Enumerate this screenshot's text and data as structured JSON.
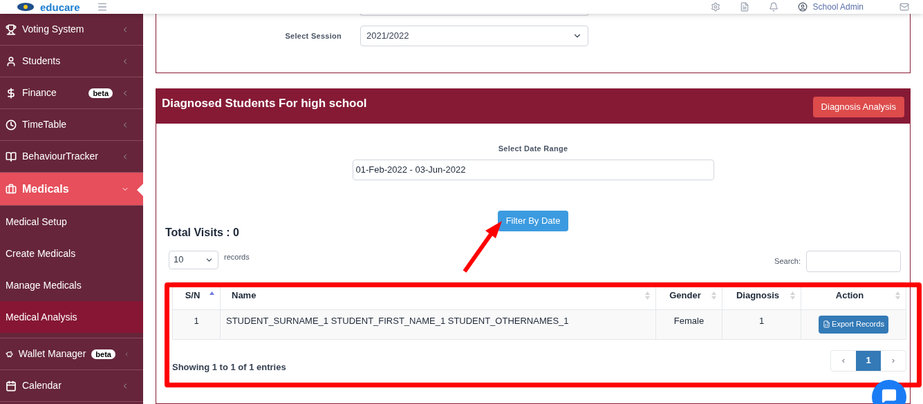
{
  "header": {
    "logo": "educare",
    "user": "School Admin"
  },
  "sidebar": {
    "items": [
      {
        "label": "Voting System",
        "expanded": false,
        "selected": false
      },
      {
        "label": "Students",
        "expanded": false,
        "selected": false
      },
      {
        "label": "Finance",
        "badge": "beta",
        "expanded": false,
        "selected": false
      },
      {
        "label": "TimeTable",
        "expanded": false,
        "selected": false
      },
      {
        "label": "BehaviourTracker",
        "expanded": false,
        "selected": false
      },
      {
        "label": "Medicals",
        "expanded": true,
        "selected": true,
        "children": [
          {
            "label": "Medical Setup",
            "selected": false
          },
          {
            "label": "Create Medicals",
            "selected": false
          },
          {
            "label": "Manage Medicals",
            "selected": false
          },
          {
            "label": "Medical Analysis",
            "selected": true
          }
        ]
      },
      {
        "label": "Wallet Manager",
        "badge": "beta",
        "expanded": false,
        "selected": false
      },
      {
        "label": "Calendar",
        "expanded": false,
        "selected": false
      }
    ]
  },
  "session_form": {
    "label": "Select Session",
    "value": "2021/2022"
  },
  "panel": {
    "title": "Diagnosed Students For high school",
    "analysis_button": "Diagnosis Analysis",
    "date_range": {
      "label": "Select Date Range",
      "value": "01-Feb-2022 - 03-Jun-2022"
    },
    "filter_button": "Filter By Date",
    "total_visits": "Total Visits : 0",
    "page_length": {
      "value": "10",
      "label": "records"
    },
    "search_label": "Search:",
    "table": {
      "columns": [
        {
          "label": "S/N",
          "sorted": true
        },
        {
          "label": "Name",
          "sorted": false
        },
        {
          "label": "Gender",
          "sorted": false
        },
        {
          "label": "Diagnosis",
          "sorted": false
        },
        {
          "label": "Action",
          "sorted": false
        }
      ],
      "rows": [
        {
          "sn": "1",
          "name": "STUDENT_SURNAME_1 STUDENT_FIRST_NAME_1 STUDENT_OTHERNAMES_1",
          "gender": "Female",
          "diagnosis": "1",
          "action": "Export Records"
        }
      ]
    },
    "info": "Showing 1 to 1 of 1 entries",
    "pagination": [
      {
        "label": "‹",
        "selected": false
      },
      {
        "label": "1",
        "selected": true
      },
      {
        "label": "›",
        "selected": false
      }
    ]
  }
}
